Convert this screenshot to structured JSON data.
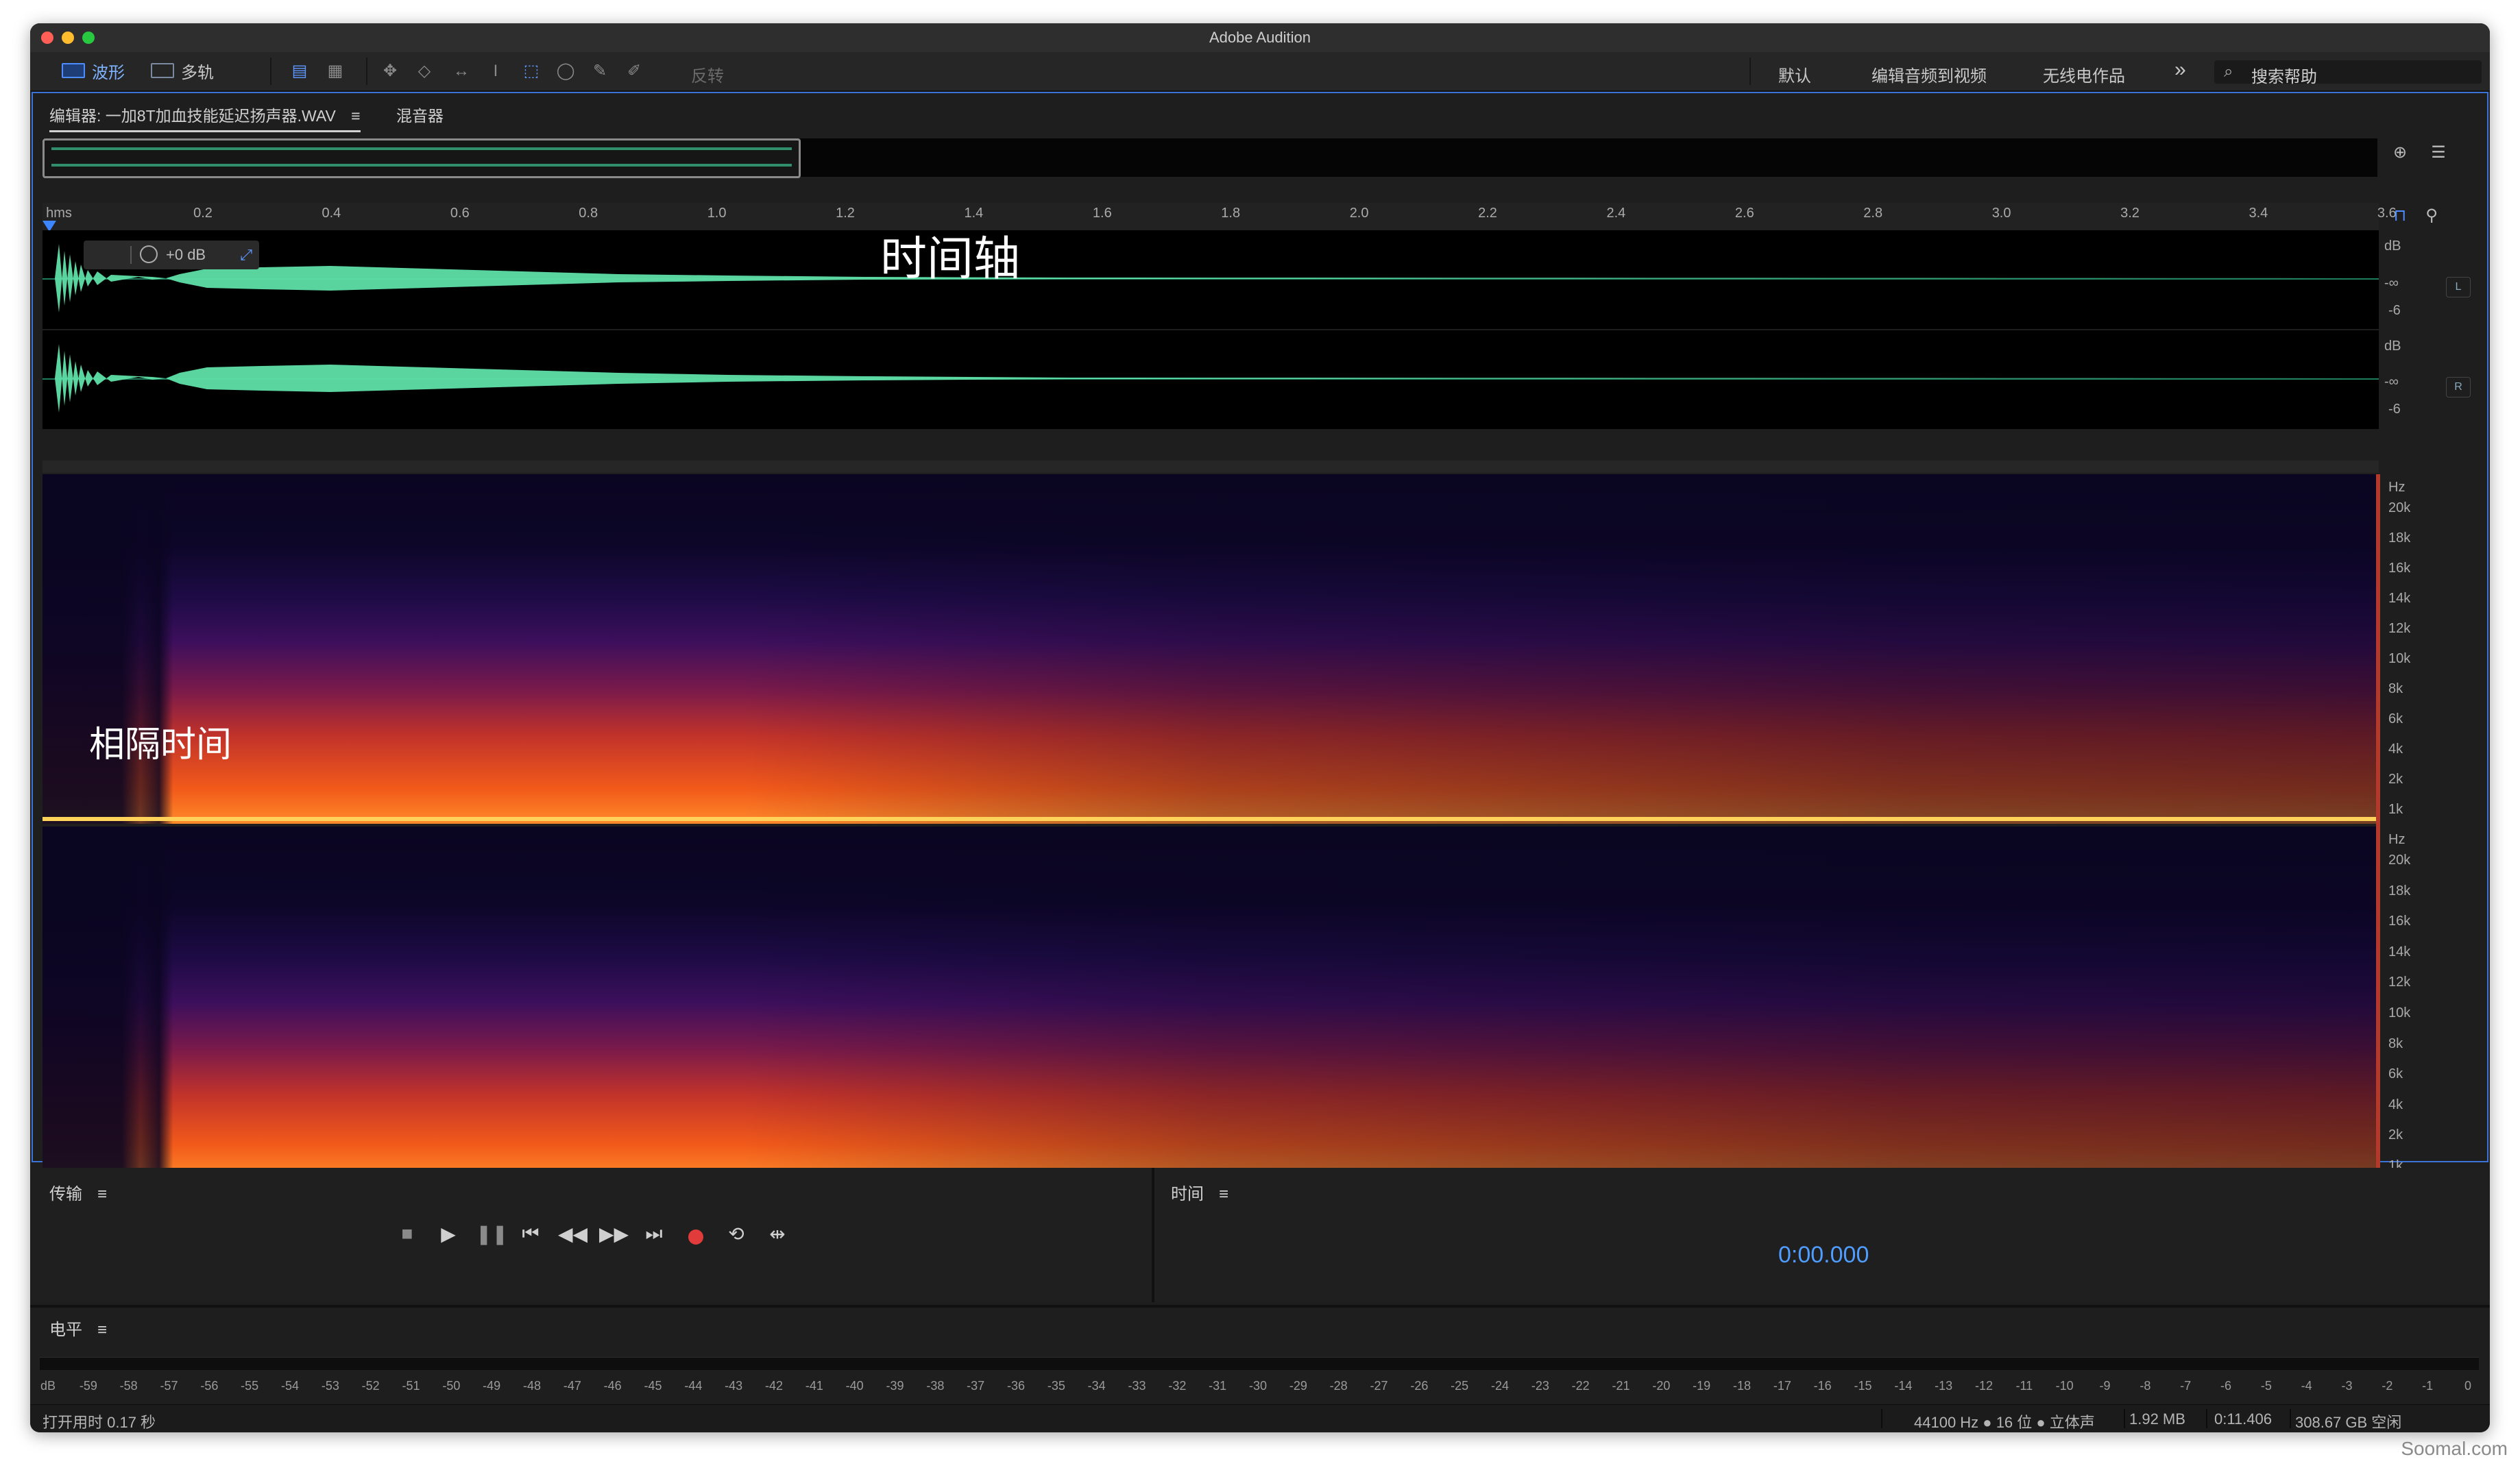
{
  "window": {
    "title": "Adobe Audition"
  },
  "toolbar": {
    "waveform_label": "波形",
    "multitrack_label": "多轨",
    "invert_label": "反转",
    "workspaces": [
      "默认",
      "编辑音频到视频",
      "无线电作品"
    ],
    "more": "»",
    "search_placeholder": "搜索帮助"
  },
  "editor": {
    "tab_editor": "编辑器: 一加8T加血技能延迟扬声器.WAV",
    "tab_menu": "≡",
    "tab_mixer": "混音器",
    "hud_gain": "+0 dB"
  },
  "ruler": {
    "unit": "hms",
    "ticks": [
      "0.2",
      "0.4",
      "0.6",
      "0.8",
      "1.0",
      "1.2",
      "1.4",
      "1.6",
      "1.8",
      "2.0",
      "2.2",
      "2.4",
      "2.6",
      "2.8",
      "3.0",
      "3.2",
      "3.4",
      "3.6"
    ]
  },
  "waveform": {
    "channels": [
      {
        "label": "L",
        "scale": [
          "dB",
          "-∞",
          "-6"
        ]
      },
      {
        "label": "R",
        "scale": [
          "dB",
          "-∞",
          "-6"
        ]
      }
    ]
  },
  "spectral": {
    "hz_labels": [
      "Hz",
      "20k",
      "18k",
      "16k",
      "14k",
      "12k",
      "10k",
      "8k",
      "6k",
      "4k",
      "2k",
      "1k"
    ]
  },
  "annotations": {
    "timeline": "时间轴",
    "interval": "相隔时间"
  },
  "transport": {
    "title": "传输",
    "menu": "≡"
  },
  "time_panel": {
    "title": "时间",
    "menu": "≡",
    "value": "0:00.000"
  },
  "levels": {
    "title": "电平",
    "menu": "≡",
    "scale": [
      "dB",
      "-59",
      "-58",
      "-57",
      "-56",
      "-55",
      "-54",
      "-53",
      "-52",
      "-51",
      "-50",
      "-49",
      "-48",
      "-47",
      "-46",
      "-45",
      "-44",
      "-43",
      "-42",
      "-41",
      "-40",
      "-39",
      "-38",
      "-37",
      "-36",
      "-35",
      "-34",
      "-33",
      "-32",
      "-31",
      "-30",
      "-29",
      "-28",
      "-27",
      "-26",
      "-25",
      "-24",
      "-23",
      "-22",
      "-21",
      "-20",
      "-19",
      "-18",
      "-17",
      "-16",
      "-15",
      "-14",
      "-13",
      "-12",
      "-11",
      "-10",
      "-9",
      "-8",
      "-7",
      "-6",
      "-5",
      "-4",
      "-3",
      "-2",
      "-1",
      "0"
    ]
  },
  "status": {
    "open_time": "打开用时 0.17 秒",
    "format": "44100 Hz ● 16 位 ● 立体声",
    "size": "1.92 MB",
    "duration": "0:11.406",
    "free": "308.67 GB 空闲"
  },
  "watermark": "Soomal.com"
}
